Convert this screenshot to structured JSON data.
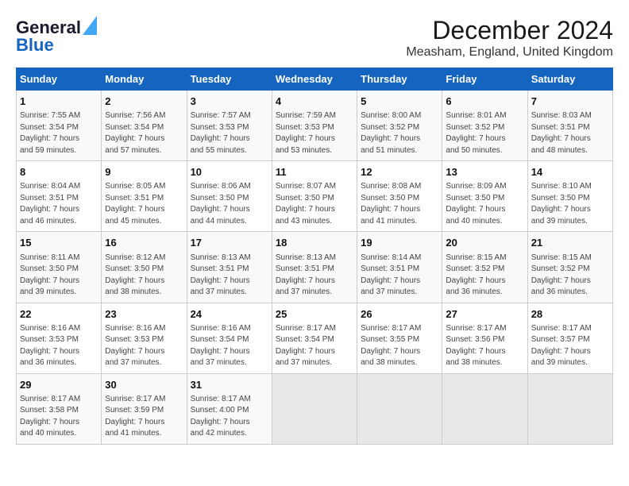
{
  "header": {
    "logo_line1": "General",
    "logo_line2": "Blue",
    "title": "December 2024",
    "subtitle": "Measham, England, United Kingdom"
  },
  "calendar": {
    "days_of_week": [
      "Sunday",
      "Monday",
      "Tuesday",
      "Wednesday",
      "Thursday",
      "Friday",
      "Saturday"
    ],
    "weeks": [
      [
        {
          "day": "1",
          "info": "Sunrise: 7:55 AM\nSunset: 3:54 PM\nDaylight: 7 hours\nand 59 minutes."
        },
        {
          "day": "2",
          "info": "Sunrise: 7:56 AM\nSunset: 3:54 PM\nDaylight: 7 hours\nand 57 minutes."
        },
        {
          "day": "3",
          "info": "Sunrise: 7:57 AM\nSunset: 3:53 PM\nDaylight: 7 hours\nand 55 minutes."
        },
        {
          "day": "4",
          "info": "Sunrise: 7:59 AM\nSunset: 3:53 PM\nDaylight: 7 hours\nand 53 minutes."
        },
        {
          "day": "5",
          "info": "Sunrise: 8:00 AM\nSunset: 3:52 PM\nDaylight: 7 hours\nand 51 minutes."
        },
        {
          "day": "6",
          "info": "Sunrise: 8:01 AM\nSunset: 3:52 PM\nDaylight: 7 hours\nand 50 minutes."
        },
        {
          "day": "7",
          "info": "Sunrise: 8:03 AM\nSunset: 3:51 PM\nDaylight: 7 hours\nand 48 minutes."
        }
      ],
      [
        {
          "day": "8",
          "info": "Sunrise: 8:04 AM\nSunset: 3:51 PM\nDaylight: 7 hours\nand 46 minutes."
        },
        {
          "day": "9",
          "info": "Sunrise: 8:05 AM\nSunset: 3:51 PM\nDaylight: 7 hours\nand 45 minutes."
        },
        {
          "day": "10",
          "info": "Sunrise: 8:06 AM\nSunset: 3:50 PM\nDaylight: 7 hours\nand 44 minutes."
        },
        {
          "day": "11",
          "info": "Sunrise: 8:07 AM\nSunset: 3:50 PM\nDaylight: 7 hours\nand 43 minutes."
        },
        {
          "day": "12",
          "info": "Sunrise: 8:08 AM\nSunset: 3:50 PM\nDaylight: 7 hours\nand 41 minutes."
        },
        {
          "day": "13",
          "info": "Sunrise: 8:09 AM\nSunset: 3:50 PM\nDaylight: 7 hours\nand 40 minutes."
        },
        {
          "day": "14",
          "info": "Sunrise: 8:10 AM\nSunset: 3:50 PM\nDaylight: 7 hours\nand 39 minutes."
        }
      ],
      [
        {
          "day": "15",
          "info": "Sunrise: 8:11 AM\nSunset: 3:50 PM\nDaylight: 7 hours\nand 39 minutes."
        },
        {
          "day": "16",
          "info": "Sunrise: 8:12 AM\nSunset: 3:50 PM\nDaylight: 7 hours\nand 38 minutes."
        },
        {
          "day": "17",
          "info": "Sunrise: 8:13 AM\nSunset: 3:51 PM\nDaylight: 7 hours\nand 37 minutes."
        },
        {
          "day": "18",
          "info": "Sunrise: 8:13 AM\nSunset: 3:51 PM\nDaylight: 7 hours\nand 37 minutes."
        },
        {
          "day": "19",
          "info": "Sunrise: 8:14 AM\nSunset: 3:51 PM\nDaylight: 7 hours\nand 37 minutes."
        },
        {
          "day": "20",
          "info": "Sunrise: 8:15 AM\nSunset: 3:52 PM\nDaylight: 7 hours\nand 36 minutes."
        },
        {
          "day": "21",
          "info": "Sunrise: 8:15 AM\nSunset: 3:52 PM\nDaylight: 7 hours\nand 36 minutes."
        }
      ],
      [
        {
          "day": "22",
          "info": "Sunrise: 8:16 AM\nSunset: 3:53 PM\nDaylight: 7 hours\nand 36 minutes."
        },
        {
          "day": "23",
          "info": "Sunrise: 8:16 AM\nSunset: 3:53 PM\nDaylight: 7 hours\nand 37 minutes."
        },
        {
          "day": "24",
          "info": "Sunrise: 8:16 AM\nSunset: 3:54 PM\nDaylight: 7 hours\nand 37 minutes."
        },
        {
          "day": "25",
          "info": "Sunrise: 8:17 AM\nSunset: 3:54 PM\nDaylight: 7 hours\nand 37 minutes."
        },
        {
          "day": "26",
          "info": "Sunrise: 8:17 AM\nSunset: 3:55 PM\nDaylight: 7 hours\nand 38 minutes."
        },
        {
          "day": "27",
          "info": "Sunrise: 8:17 AM\nSunset: 3:56 PM\nDaylight: 7 hours\nand 38 minutes."
        },
        {
          "day": "28",
          "info": "Sunrise: 8:17 AM\nSunset: 3:57 PM\nDaylight: 7 hours\nand 39 minutes."
        }
      ],
      [
        {
          "day": "29",
          "info": "Sunrise: 8:17 AM\nSunset: 3:58 PM\nDaylight: 7 hours\nand 40 minutes."
        },
        {
          "day": "30",
          "info": "Sunrise: 8:17 AM\nSunset: 3:59 PM\nDaylight: 7 hours\nand 41 minutes."
        },
        {
          "day": "31",
          "info": "Sunrise: 8:17 AM\nSunset: 4:00 PM\nDaylight: 7 hours\nand 42 minutes."
        },
        {
          "day": "",
          "info": ""
        },
        {
          "day": "",
          "info": ""
        },
        {
          "day": "",
          "info": ""
        },
        {
          "day": "",
          "info": ""
        }
      ]
    ]
  }
}
